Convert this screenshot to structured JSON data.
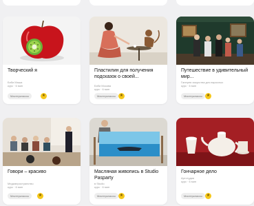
{
  "cards": [
    {
      "title": "Творческий я",
      "meta": [
        "Бэби Маша",
        "курс · 6 мин"
      ],
      "chip": "Мастерклассы",
      "badge_icon": "star-icon",
      "badge_color": "#f5c71a"
    },
    {
      "title": "Пластилин для получения подсказок о своей...",
      "meta": [
        "Бэби Москва",
        "курс · 6 мин"
      ],
      "chip": "Мастерклассы",
      "badge_icon": "star-icon",
      "badge_color": "#f5c71a"
    },
    {
      "title": "Путешествие в удивительный мир...",
      "meta": [
        "Галерея искусства для взрослых",
        "курс · 6 мин"
      ],
      "chip": "Мастерклассы",
      "badge_icon": "star-icon",
      "badge_color": "#f5c71a"
    },
    {
      "title": "Говори – красиво",
      "meta": [
        "Медиапространство",
        "курс · 6 мин"
      ],
      "chip": "Мастерклассы",
      "badge_icon": "star-icon",
      "badge_color": "#f5c71a"
    },
    {
      "title": "Масляная живопись в Studio Pasparty",
      "meta": [
        "в Studio",
        "курс · 6 мин"
      ],
      "chip": "Мастерклассы",
      "badge_icon": "star-icon",
      "badge_color": "#f5c71a"
    },
    {
      "title": "Гончарное дело",
      "meta": [
        "Артстудия",
        "курс · 6 мин"
      ],
      "chip": "Мастерклассы",
      "badge_icon": "star-icon",
      "badge_color": "#f5c71a"
    }
  ],
  "badge_glyph": "★"
}
